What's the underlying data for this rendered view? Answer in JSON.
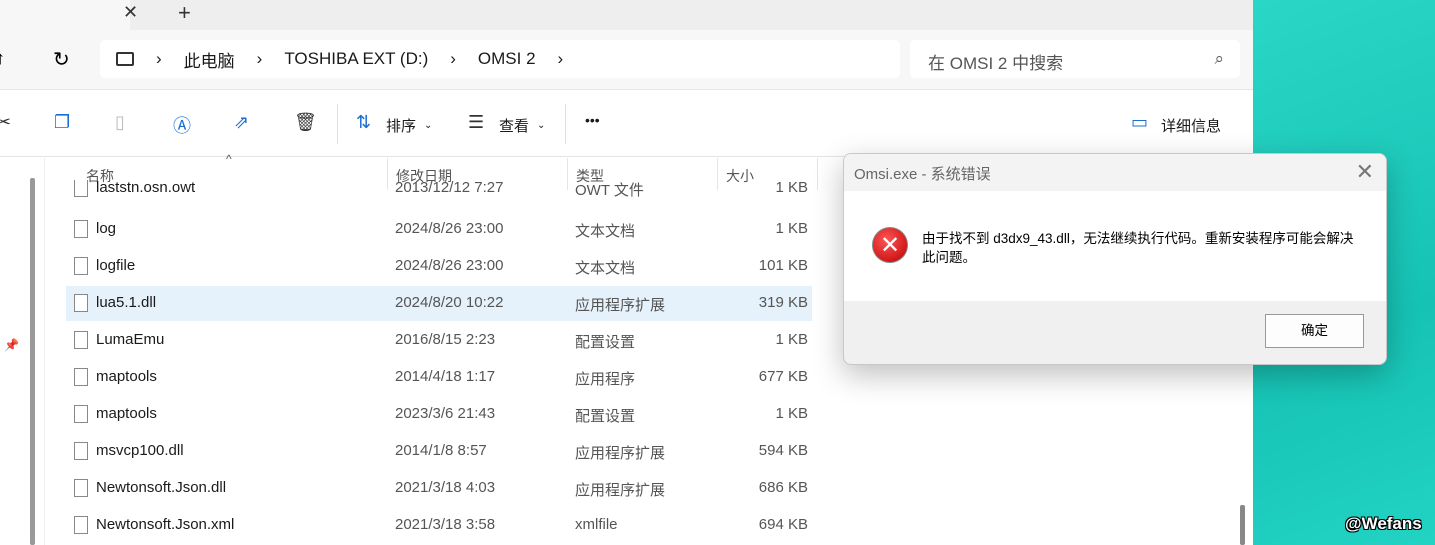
{
  "tabbar": {
    "close": "✕",
    "new_tab": "+"
  },
  "nav": {
    "up": "↑",
    "refresh": "↻",
    "breadcrumb": [
      "此电脑",
      "TOSHIBA EXT (D:)",
      "OMSI 2"
    ],
    "sep": "›",
    "search_placeholder": "在 OMSI 2 中搜索"
  },
  "toolbar": {
    "sort": "排序",
    "view": "查看",
    "more": "•••",
    "details": "详细信息"
  },
  "columns": [
    "名称",
    "修改日期",
    "类型",
    "大小"
  ],
  "files": [
    {
      "name": "laststn.osn.owt",
      "date": "2013/12/12 7:27",
      "type": "OWT 文件",
      "size": "1 KB"
    },
    {
      "name": "log",
      "date": "2024/8/26 23:00",
      "type": "文本文档",
      "size": "1 KB"
    },
    {
      "name": "logfile",
      "date": "2024/8/26 23:00",
      "type": "文本文档",
      "size": "101 KB"
    },
    {
      "name": "lua5.1.dll",
      "date": "2024/8/20 10:22",
      "type": "应用程序扩展",
      "size": "319 KB"
    },
    {
      "name": "LumaEmu",
      "date": "2016/8/15 2:23",
      "type": "配置设置",
      "size": "1 KB"
    },
    {
      "name": "maptools",
      "date": "2014/4/18 1:17",
      "type": "应用程序",
      "size": "677 KB"
    },
    {
      "name": "maptools",
      "date": "2023/3/6 21:43",
      "type": "配置设置",
      "size": "1 KB"
    },
    {
      "name": "msvcp100.dll",
      "date": "2014/1/8 8:57",
      "type": "应用程序扩展",
      "size": "594 KB"
    },
    {
      "name": "Newtonsoft.Json.dll",
      "date": "2021/3/18 4:03",
      "type": "应用程序扩展",
      "size": "686 KB"
    },
    {
      "name": "Newtonsoft.Json.xml",
      "date": "2021/3/18 3:58",
      "type": "xmlfile",
      "size": "694 KB"
    }
  ],
  "dialog": {
    "title": "Omsi.exe - 系统错误",
    "message": "由于找不到 d3dx9_43.dll，无法继续执行代码。重新安装程序可能会解决此问题。",
    "ok": "确定"
  },
  "watermark": "@Wefans"
}
